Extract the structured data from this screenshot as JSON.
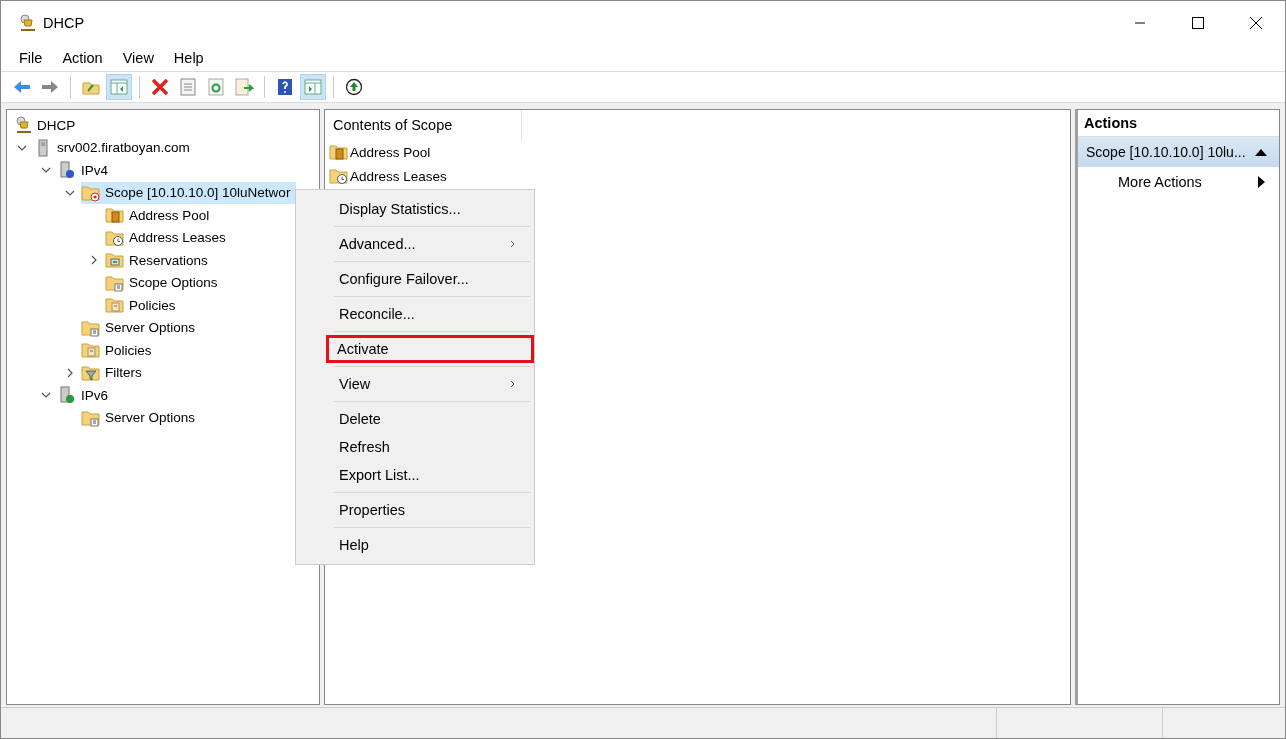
{
  "window": {
    "title": "DHCP"
  },
  "menu_bar": [
    "File",
    "Action",
    "View",
    "Help"
  ],
  "toolbar": [
    {
      "kind": "back",
      "pressed": false
    },
    {
      "kind": "forward",
      "pressed": false
    },
    {
      "kind": "up",
      "pressed": false
    },
    {
      "kind": "console-tree",
      "pressed": true
    },
    {
      "kind": "delete",
      "pressed": false
    },
    {
      "kind": "properties",
      "pressed": false
    },
    {
      "kind": "refresh",
      "pressed": false
    },
    {
      "kind": "export",
      "pressed": false
    },
    {
      "kind": "help",
      "pressed": false
    },
    {
      "kind": "action-pane",
      "pressed": true
    },
    {
      "kind": "activate",
      "pressed": false
    }
  ],
  "tree": [
    {
      "label": "DHCP",
      "kind": "root",
      "selected": false,
      "children": [
        {
          "label": "srv002.firatboyan.com",
          "kind": "server",
          "selected": false,
          "expanded": true,
          "children": [
            {
              "label": "IPv4",
              "kind": "ipv4",
              "selected": false,
              "expanded": true,
              "children": [
                {
                  "label": "Scope [10.10.10.0] 10luNetwor",
                  "kind": "scope",
                  "selected": true,
                  "expanded": true,
                  "children": [
                    {
                      "label": "Address Pool",
                      "kind": "pool",
                      "selected": false
                    },
                    {
                      "label": "Address Leases",
                      "kind": "leases",
                      "selected": false
                    },
                    {
                      "label": "Reservations",
                      "kind": "reservations",
                      "selected": false,
                      "expanded": false
                    },
                    {
                      "label": "Scope Options",
                      "kind": "options",
                      "selected": false
                    },
                    {
                      "label": "Policies",
                      "kind": "policies",
                      "selected": false
                    }
                  ]
                },
                {
                  "label": "Server Options",
                  "kind": "options",
                  "selected": false
                },
                {
                  "label": "Policies",
                  "kind": "policies",
                  "selected": false
                },
                {
                  "label": "Filters",
                  "kind": "filters",
                  "selected": false,
                  "expanded": false
                }
              ]
            },
            {
              "label": "IPv6",
              "kind": "ipv6",
              "selected": false,
              "expanded": true,
              "children": [
                {
                  "label": "Server Options",
                  "kind": "options",
                  "selected": false
                }
              ]
            }
          ]
        }
      ]
    }
  ],
  "content": {
    "column": "Contents of Scope",
    "items": [
      {
        "label": "Address Pool",
        "kind": "pool"
      },
      {
        "label": "Address Leases",
        "kind": "leases"
      }
    ]
  },
  "context_menu": [
    [
      {
        "label": "Display Statistics...",
        "submenu": false,
        "highlighted": false
      }
    ],
    [
      {
        "label": "Advanced...",
        "submenu": true,
        "highlighted": false
      }
    ],
    [
      {
        "label": "Configure Failover...",
        "submenu": false,
        "highlighted": false
      }
    ],
    [
      {
        "label": "Reconcile...",
        "submenu": false,
        "highlighted": false
      }
    ],
    [
      {
        "label": "Activate",
        "submenu": false,
        "highlighted": true
      }
    ],
    [
      {
        "label": "View",
        "submenu": true,
        "highlighted": false
      }
    ],
    [
      {
        "label": "Delete",
        "submenu": false,
        "highlighted": false
      },
      {
        "label": "Refresh",
        "submenu": false,
        "highlighted": false
      },
      {
        "label": "Export List...",
        "submenu": false,
        "highlighted": false
      }
    ],
    [
      {
        "label": "Properties",
        "submenu": false,
        "highlighted": false
      }
    ],
    [
      {
        "label": "Help",
        "submenu": false,
        "highlighted": false
      }
    ]
  ],
  "actions": {
    "title": "Actions",
    "section": {
      "label": "Scope [10.10.10.0] 10lu...",
      "expanded": true
    },
    "items": [
      {
        "label": "More Actions",
        "submenu": true
      }
    ]
  }
}
